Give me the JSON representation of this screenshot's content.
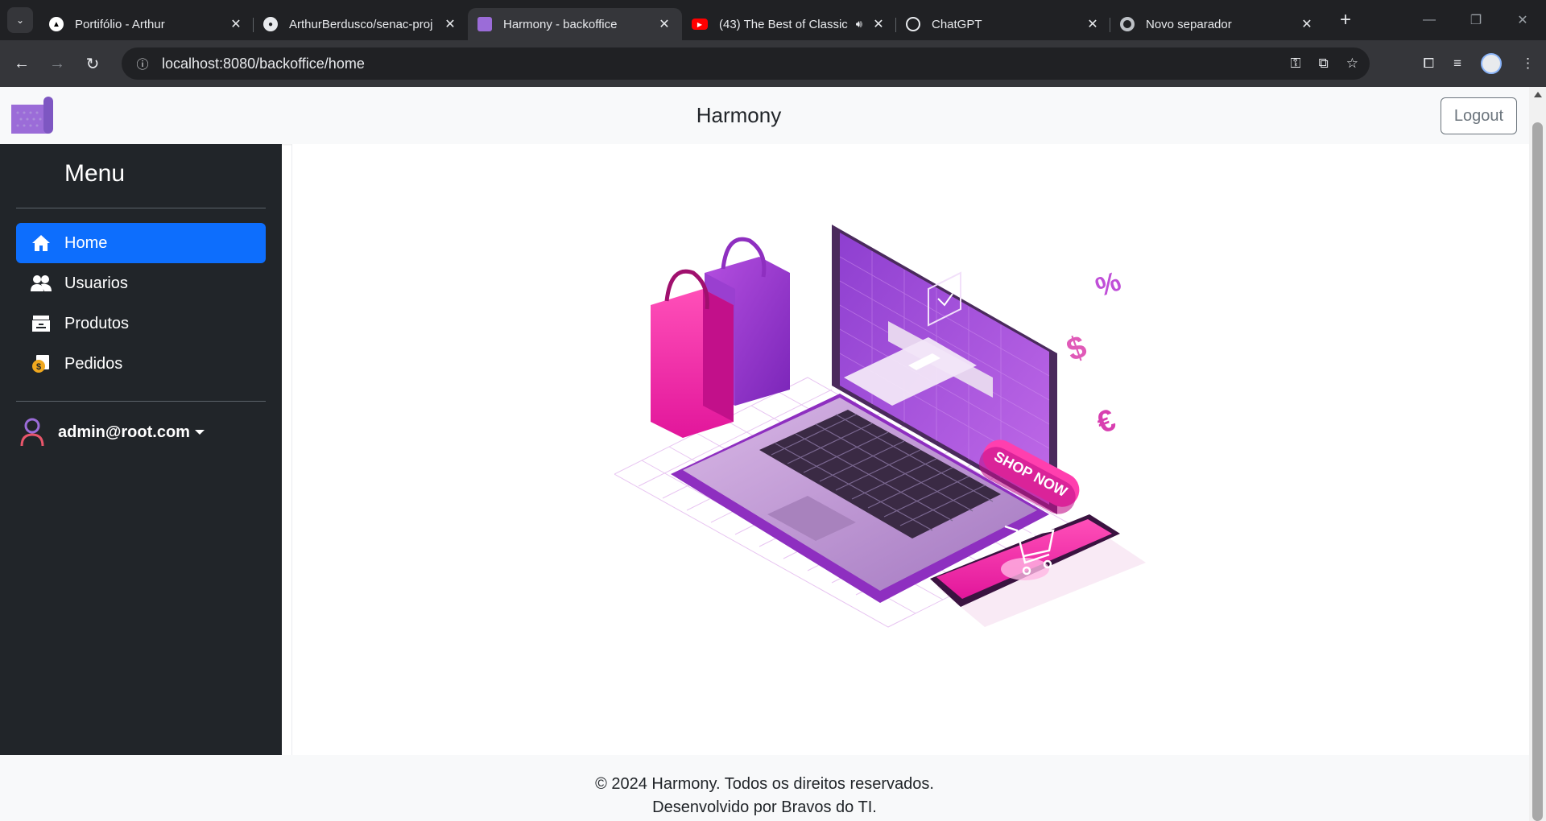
{
  "browser": {
    "tabs": [
      {
        "title": "Portifólio - Arthur",
        "icon": "triangle-icon"
      },
      {
        "title": "ArthurBerdusco/senac-proj",
        "icon": "github-icon"
      },
      {
        "title": "Harmony - backoffice",
        "icon": "harmony-icon",
        "active": true
      },
      {
        "title": "(43) The Best of Classic",
        "icon": "youtube-icon",
        "audio": true
      },
      {
        "title": "ChatGPT",
        "icon": "chatgpt-icon"
      },
      {
        "title": "Novo separador",
        "icon": "chrome-icon"
      }
    ],
    "url": "localhost:8080/backoffice/home"
  },
  "header": {
    "title": "Harmony",
    "logout_label": "Logout"
  },
  "sidebar": {
    "menu_title": "Menu",
    "items": [
      {
        "label": "Home",
        "icon": "home-icon",
        "active": true
      },
      {
        "label": "Usuarios",
        "icon": "users-icon"
      },
      {
        "label": "Produtos",
        "icon": "products-icon"
      },
      {
        "label": "Pedidos",
        "icon": "orders-icon"
      }
    ],
    "user": "admin@root.com"
  },
  "hero": {
    "shop_now": "SHOP NOW"
  },
  "footer": {
    "line1": "© 2024 Harmony. Todos os direitos reservados.",
    "line2": "Desenvolvido por Bravos do TI."
  },
  "colors": {
    "accent": "#0d6efd",
    "sidebar_bg": "#212529",
    "brand_purple": "#9b6cd8"
  }
}
